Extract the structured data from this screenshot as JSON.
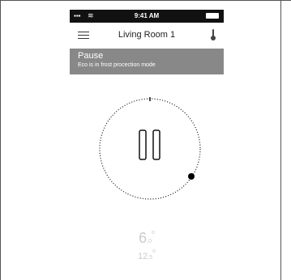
{
  "status_bar": {
    "time": "9:41 AM"
  },
  "nav": {
    "title": "Living Room 1"
  },
  "banner": {
    "title": "Pause",
    "subtitle": "Eco is in frost procection mode"
  },
  "dial": {
    "state": "paused"
  },
  "readings": {
    "primary": {
      "whole": "6",
      "decimal": ",0",
      "unit": "o"
    },
    "secondary": {
      "whole": "12",
      "decimal": ",5",
      "unit": "o"
    }
  }
}
